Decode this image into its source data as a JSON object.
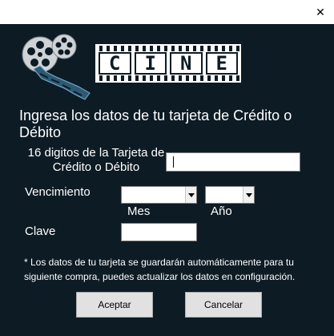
{
  "window": {
    "close_glyph": "✕"
  },
  "brand": {
    "letters": [
      "C",
      "I",
      "N",
      "E"
    ]
  },
  "form": {
    "heading": "Ingresa los datos de tu tarjeta de Crédito o Débito",
    "card_label": "16 digitos de la Tarjeta de Crédito o Débito",
    "card_value": "",
    "expiry_label": "Vencimiento",
    "month_label": "Mes",
    "year_label": "Año",
    "month_value": "",
    "year_value": "",
    "pin_label": "Clave",
    "pin_value": "",
    "note": "* Los datos de tu tarjeta se guardarán automáticamente para tu siguiente compra, puedes actualizar los datos en configuración."
  },
  "buttons": {
    "accept": "Aceptar",
    "cancel": "Cancelar"
  },
  "colors": {
    "panel_background": "#0d1b24",
    "text": "#ffffff",
    "button_face": "#e1e1e1"
  },
  "icons": {
    "close": "close-icon",
    "logo": "film-reel-icon",
    "dropdown": "chevron-down-icon"
  }
}
